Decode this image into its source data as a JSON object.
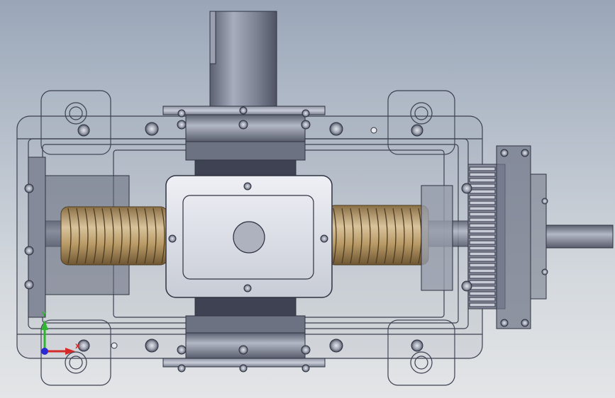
{
  "viewport": {
    "background_top": "#9aa6b8",
    "background_bottom": "#e3e5e7"
  },
  "model": {
    "view": "top",
    "display_mode": "transparent-shaded",
    "worm_color": "#b89a66",
    "housing_color": "#5a6274"
  },
  "triad": {
    "y_label": "Y",
    "x_label": "X",
    "y_color": "#2fb52f",
    "x_color": "#d42a2a",
    "z_color": "#2a2ad4"
  }
}
